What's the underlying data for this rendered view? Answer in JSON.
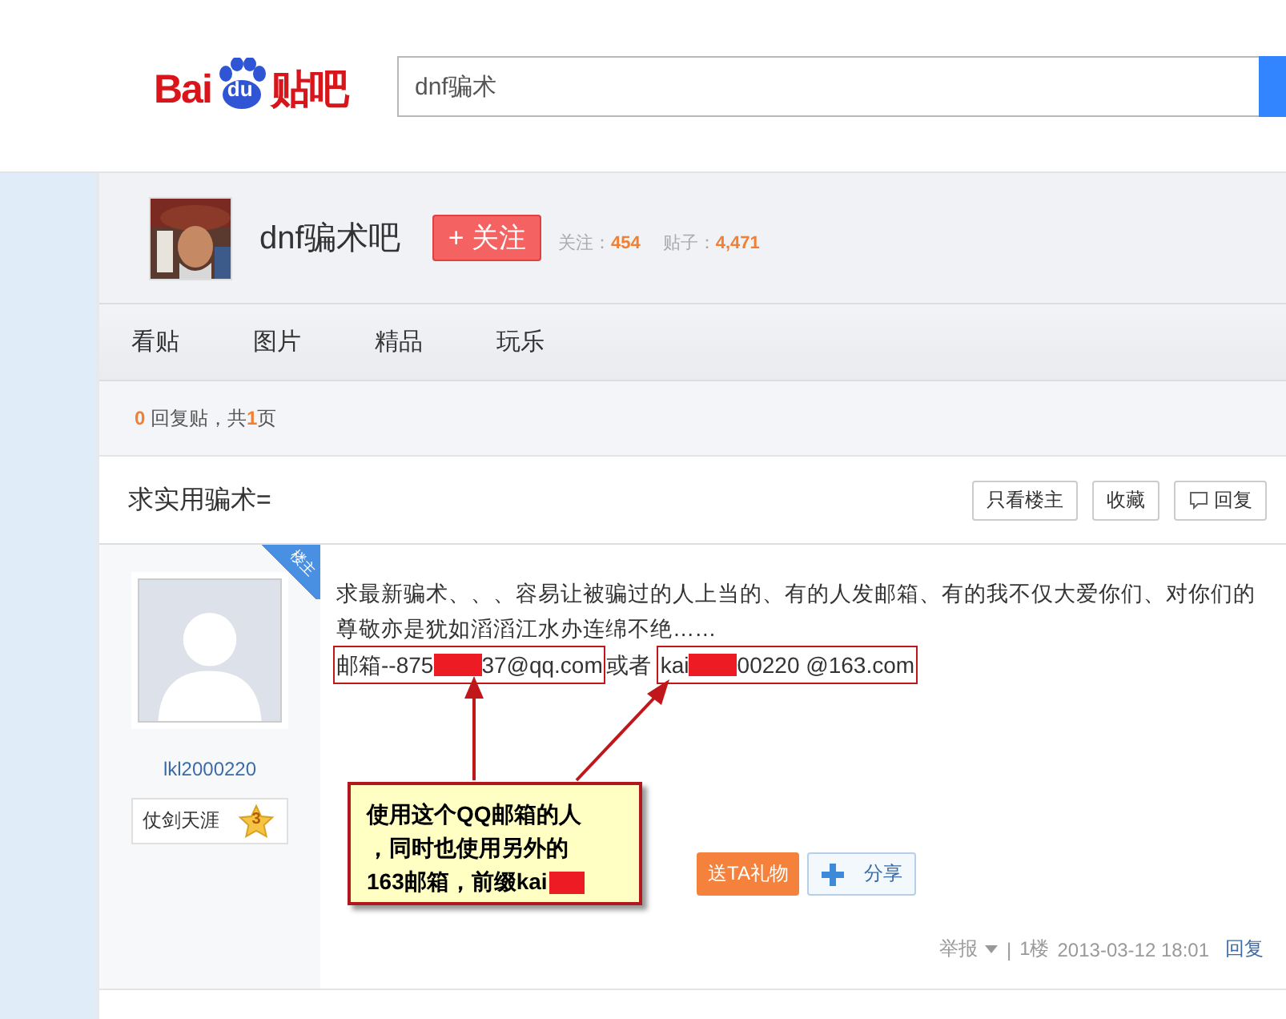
{
  "header": {
    "logo": {
      "left": "Bai",
      "mark": "du",
      "right": "贴吧"
    },
    "search": {
      "value": "dnf骗术"
    }
  },
  "forum": {
    "name": "dnf骗术吧",
    "follow_button": "+ 关注",
    "stats": [
      {
        "label": "关注：",
        "value": "454"
      },
      {
        "label": "贴子：",
        "value": "4,471"
      }
    ]
  },
  "tabs": [
    {
      "label": "看贴"
    },
    {
      "label": "图片"
    },
    {
      "label": "精品"
    },
    {
      "label": "玩乐"
    }
  ],
  "reply_info": {
    "count": "0",
    "middle": " 回复贴，共",
    "pages": "1",
    "end": "页"
  },
  "thread": {
    "title": "求实用骗术=",
    "buttons": [
      {
        "label": "只看楼主",
        "icon": false
      },
      {
        "label": "收藏",
        "icon": false
      },
      {
        "label": "回复",
        "icon": true
      }
    ]
  },
  "post": {
    "badge": "楼主",
    "author": "lkl2000220",
    "title_badge": {
      "name": "仗剑天涯",
      "level": "3"
    },
    "text": "求最新骗术、、、容易让被骗过的人上当的、有的人发邮箱、有的我不仅大爱你们、对你们的尊敬亦是犹如滔滔江水办连绵不绝……",
    "email_line": [
      {
        "kind": "boxed",
        "parts": [
          {
            "kind": "text",
            "text": "邮箱--875"
          },
          {
            "kind": "redaction"
          },
          {
            "kind": "text",
            "text": "37@qq.com"
          }
        ]
      },
      {
        "kind": "plain",
        "parts": [
          {
            "kind": "text",
            "text": "或者"
          }
        ]
      },
      {
        "kind": "boxed",
        "parts": [
          {
            "kind": "text",
            "text": "kai"
          },
          {
            "kind": "redaction"
          },
          {
            "kind": "text",
            "text": "00220 @163.com"
          }
        ]
      }
    ],
    "callout": {
      "lines": [
        "使用这个QQ邮箱的人",
        "，同时也使用另外的",
        "163邮箱，前缀kai"
      ]
    },
    "gift_button": "送TA礼物",
    "share_button": "分享",
    "footer": {
      "report": "举报",
      "separator": "|",
      "floor": "1楼",
      "time": "2013-03-12 18:01",
      "reply": "回复"
    }
  }
}
